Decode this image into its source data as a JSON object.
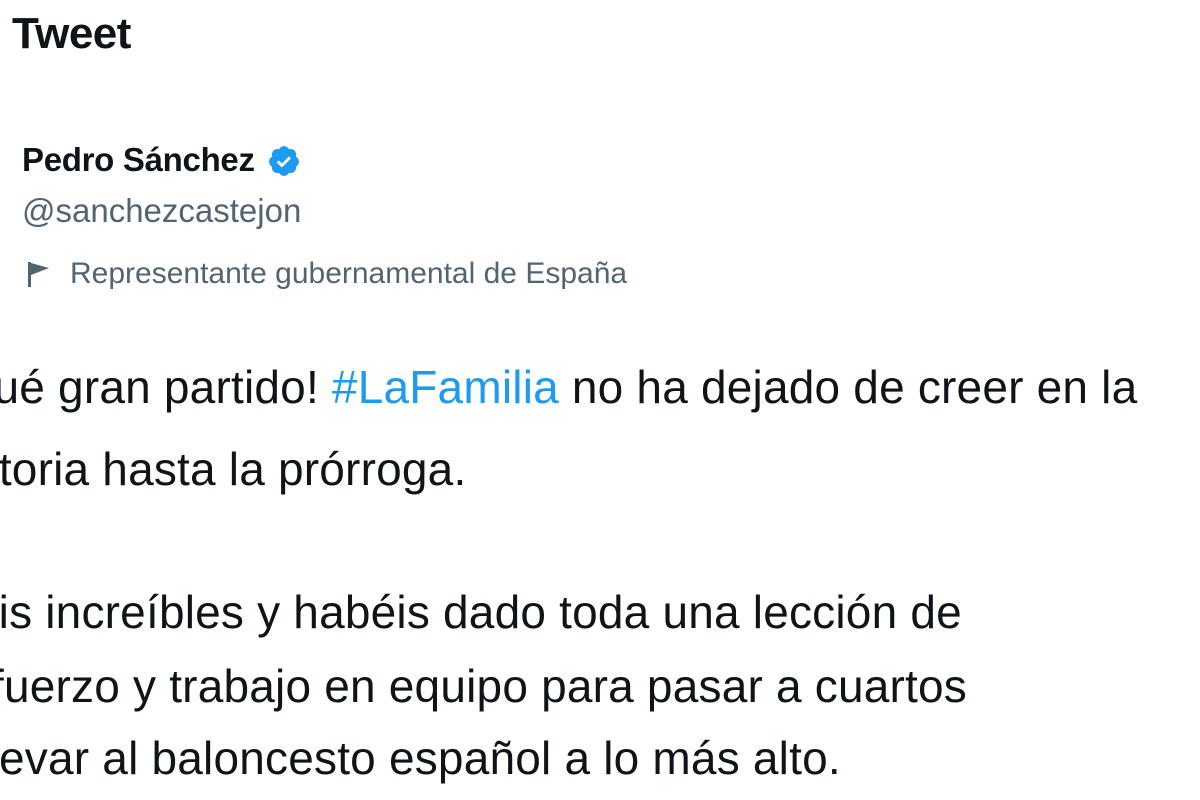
{
  "header": {
    "title": "Tweet"
  },
  "author": {
    "name": "Pedro Sánchez",
    "handle": "@sanchezcastejon",
    "verified": true,
    "verified_icon": "verified-badge-icon",
    "label_icon": "flag-icon",
    "label": "Representante gubernamental de España"
  },
  "tweet": {
    "line1_prefix": "¡Qué gran partido! ",
    "line1_hashtag": "#LaFamilia",
    "line1_suffix": " no ha dejado de creer en la",
    "line2": "victoria hasta la prórroga.",
    "line3": "Sois increíbles y habéis dado toda una lección de",
    "line4": "esfuerzo y trabajo en equipo para pasar a cuartos",
    "line5": "y llevar al baloncesto español a lo más alto."
  },
  "colors": {
    "text": "#0f1419",
    "secondary": "#536471",
    "accent": "#1d9bf0"
  }
}
